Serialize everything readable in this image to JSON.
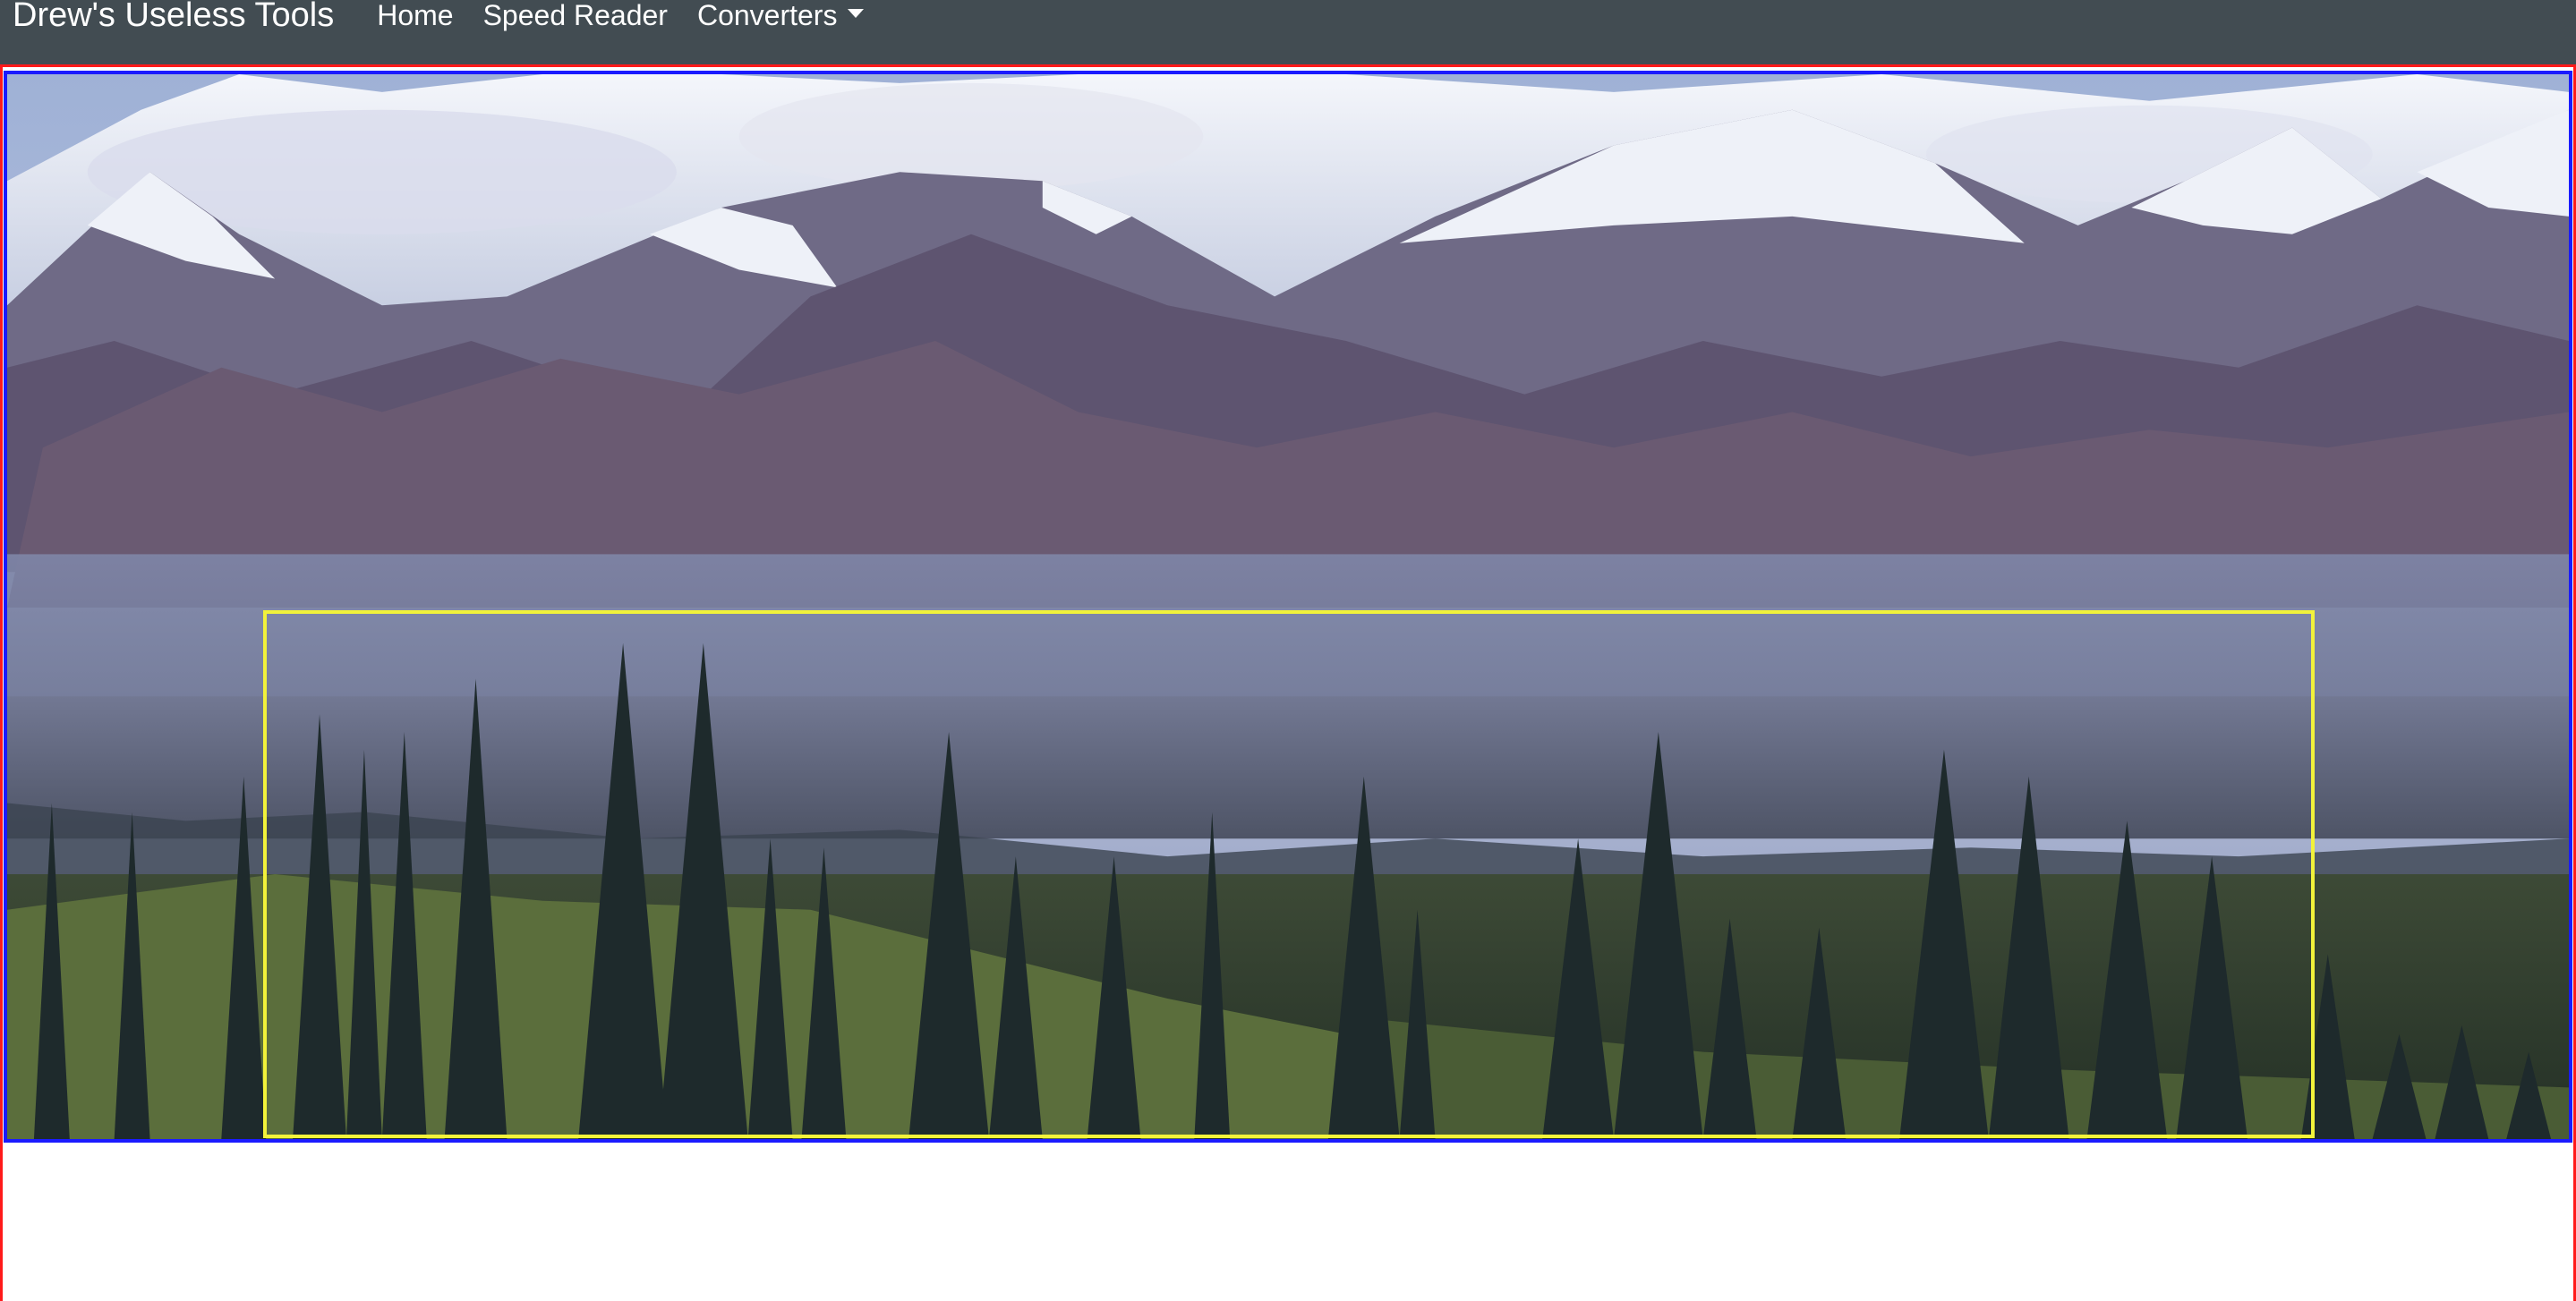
{
  "navbar": {
    "brand": "Drew's Useless Tools",
    "links": [
      {
        "label": "Home"
      },
      {
        "label": "Speed Reader"
      },
      {
        "label": "Converters",
        "dropdown": true
      }
    ],
    "background": "#424c52"
  },
  "hero": {
    "image_icon": "mountain-landscape-image",
    "frame_color": "#1a1aff",
    "highlight_color": "#f2f23a"
  },
  "page": {
    "outline_color": "#ff1a1a"
  }
}
